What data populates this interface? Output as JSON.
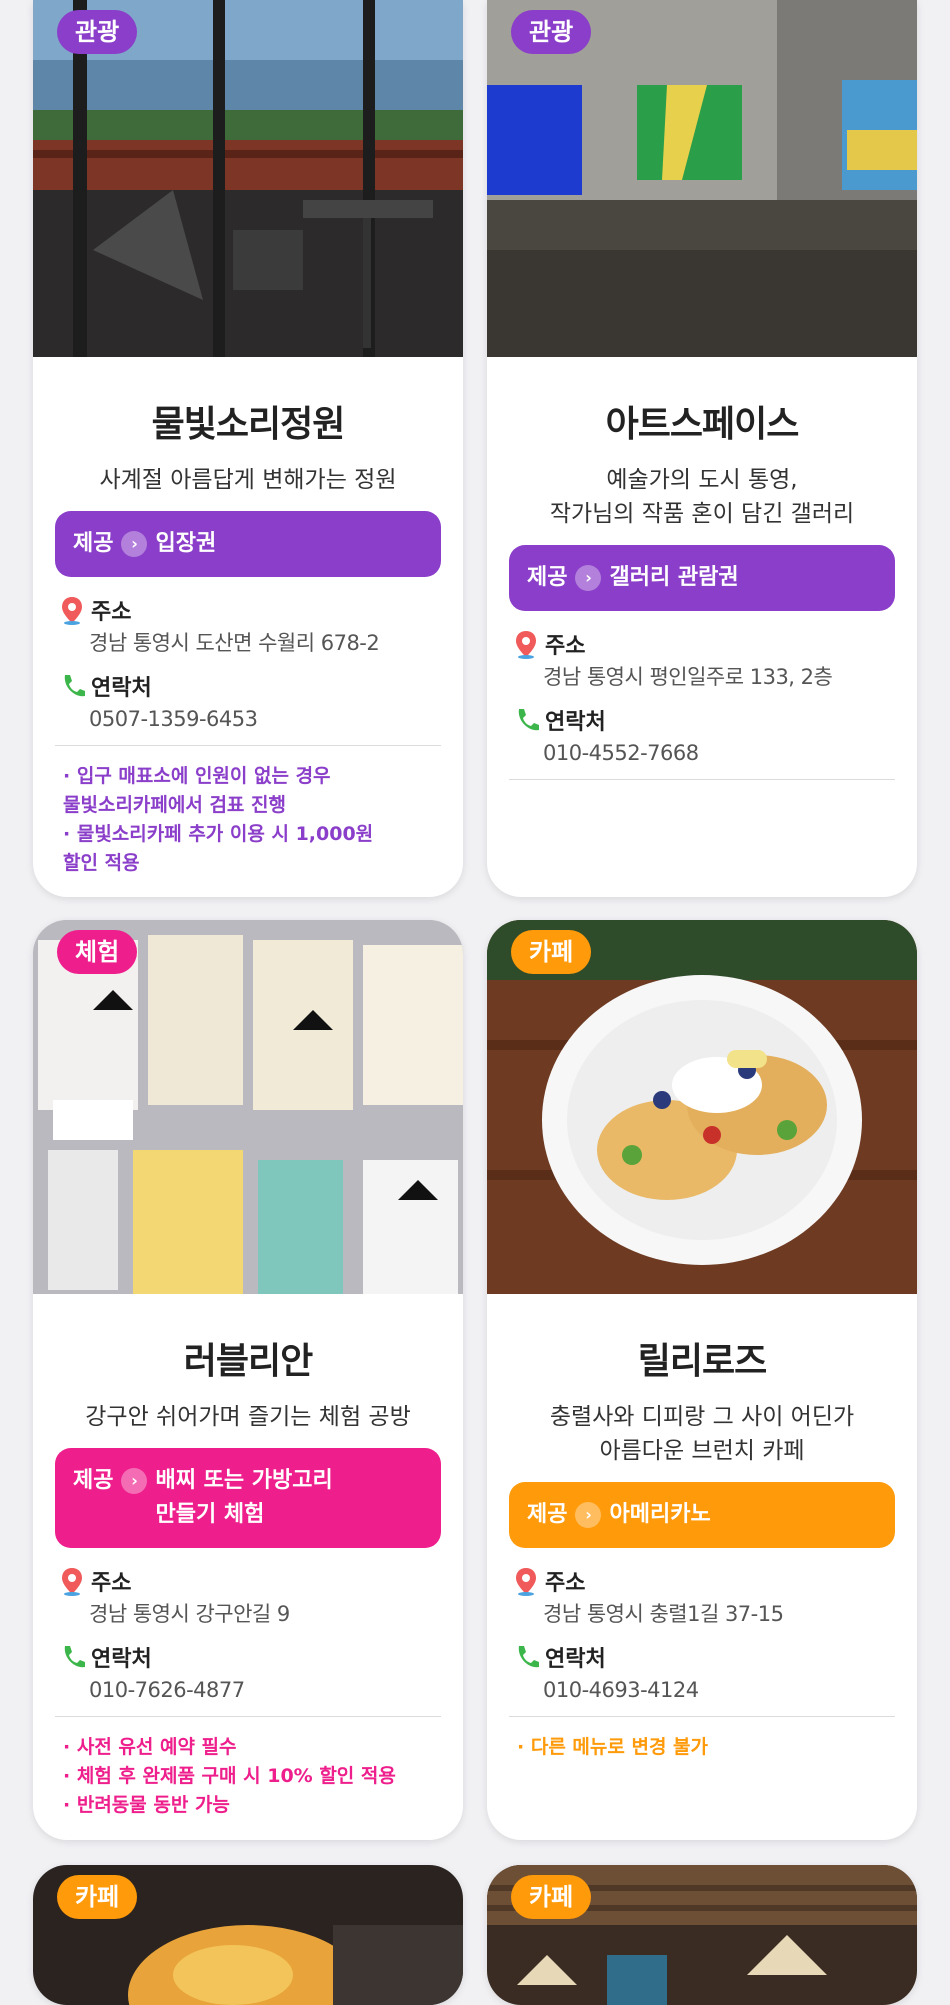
{
  "cards": [
    {
      "badge": "관광",
      "badge_color": "#8a3ec9",
      "title": "물빛소리정원",
      "subtitle": "사계절 아름답게 변해가는 정원",
      "offer_label": "제공",
      "offer_value": "입장권",
      "offer_color": "#8a3ec9",
      "address_label": "주소",
      "address": "경남 통영시 도산면 수월리 678-2",
      "contact_label": "연락처",
      "contact": "0507-1359-6453",
      "notes": [
        "· 입구 매표소에 인원이 없는 경우\n  물빛소리카페에서 검표 진행",
        "· 물빛소리카페 추가 이용 시 1,000원\n  할인 적용"
      ],
      "notes_color": "#8a3ec9"
    },
    {
      "badge": "관광",
      "badge_color": "#8a3ec9",
      "title": "아트스페이스",
      "subtitle": "예술가의 도시 통영,\n작가님의 작품 혼이 담긴 갤러리",
      "offer_label": "제공",
      "offer_value": "갤러리 관람권",
      "offer_color": "#8a3ec9",
      "address_label": "주소",
      "address": "경남 통영시 평인일주로 133, 2층",
      "contact_label": "연락처",
      "contact": "010-4552-7668",
      "notes": []
    },
    {
      "badge": "체험",
      "badge_color": "#ee1f8c",
      "title": "러블리안",
      "subtitle": "강구안 쉬어가며 즐기는 체험 공방",
      "offer_label": "제공",
      "offer_value": "배찌 또는 가방고리\n만들기 체험",
      "offer_color": "#ee1f8c",
      "address_label": "주소",
      "address": "경남 통영시 강구안길 9",
      "contact_label": "연락처",
      "contact": "010-7626-4877",
      "notes": [
        "· 사전 유선 예약 필수",
        "· 체험 후 완제품 구매 시 10% 할인 적용",
        "· 반려동물 동반 가능"
      ],
      "notes_color": "#ee1f8c"
    },
    {
      "badge": "카페",
      "badge_color": "#ff9a0a",
      "title": "릴리로즈",
      "subtitle": "충렬사와 디피랑 그 사이 어딘가\n아름다운 브런치 카페",
      "offer_label": "제공",
      "offer_value": "아메리카노",
      "offer_color": "#ff9a0a",
      "address_label": "주소",
      "address": "경남 통영시 충렬1길 37-15",
      "contact_label": "연락처",
      "contact": "010-4693-4124",
      "notes": [
        "· 다른 메뉴로 변경 불가"
      ],
      "notes_color": "#ff9a0a"
    },
    {
      "badge": "카페",
      "badge_color": "#ff9a0a"
    },
    {
      "badge": "카페",
      "badge_color": "#ff9a0a"
    }
  ],
  "icons": {
    "address": "map-pin-icon",
    "contact": "phone-icon",
    "offer_arrow": "chevron-right-icon"
  }
}
